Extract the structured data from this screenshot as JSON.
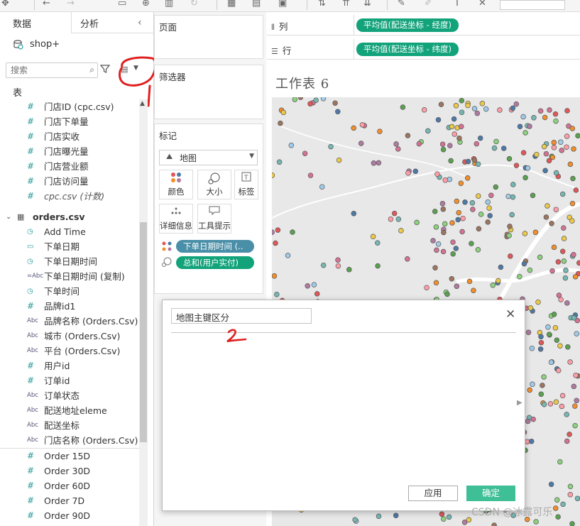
{
  "left_pane": {
    "tabs": {
      "data": "数据",
      "analysis": "分析"
    },
    "datasource": "shop+",
    "search_placeholder": "搜索",
    "section_label": "表",
    "fields": [
      {
        "label": "门店ID (cpc.csv)",
        "type": "measure"
      },
      {
        "label": "门店下单量",
        "type": "measure"
      },
      {
        "label": "门店实收",
        "type": "measure"
      },
      {
        "label": "门店曝光量",
        "type": "measure"
      },
      {
        "label": "门店营业额",
        "type": "measure"
      },
      {
        "label": "门店访问量",
        "type": "measure"
      },
      {
        "label": "cpc.csv (计数)",
        "type": "measure-italic"
      },
      {
        "label": "orders.csv",
        "type": "table"
      },
      {
        "label": "Add Time",
        "type": "datetime"
      },
      {
        "label": "下单日期",
        "type": "date"
      },
      {
        "label": "下单日期时间",
        "type": "datetime"
      },
      {
        "label": "下单日期时间 (复制)",
        "type": "string-date"
      },
      {
        "label": "下单时间",
        "type": "datetime"
      },
      {
        "label": "品牌id1",
        "type": "measure"
      },
      {
        "label": "品牌名称 (Orders.Csv)",
        "type": "string"
      },
      {
        "label": "城市 (Orders.Csv)",
        "type": "string"
      },
      {
        "label": "平台 (Orders.Csv)",
        "type": "string"
      },
      {
        "label": "用户id",
        "type": "measure"
      },
      {
        "label": "订单id",
        "type": "measure"
      },
      {
        "label": "订单状态",
        "type": "string"
      },
      {
        "label": "配送地址eleme",
        "type": "string"
      },
      {
        "label": "配送坐标",
        "type": "string"
      },
      {
        "label": "门店名称 (Orders.Csv)",
        "type": "string"
      },
      {
        "label": "Order 15D",
        "type": "measure"
      },
      {
        "label": "Order 30D",
        "type": "measure"
      },
      {
        "label": "Order 60D",
        "type": "measure"
      },
      {
        "label": "Order 7D",
        "type": "measure"
      },
      {
        "label": "Order 90D",
        "type": "measure"
      }
    ]
  },
  "shelves": {
    "pages": "页面",
    "filters": "筛选器",
    "marks": "标记",
    "mark_type": "地图",
    "mark_buttons": {
      "color": "颜色",
      "size": "大小",
      "label": "标签",
      "detail": "详细信息",
      "tooltip": "工具提示"
    },
    "mark_pills": [
      {
        "label": "下单日期时间 (..",
        "color": "#4a8fa8"
      },
      {
        "label": "总和(用户实付)",
        "color": "#12a37b"
      }
    ]
  },
  "columns_shelf": {
    "label": "列",
    "pill": "平均值(配送坐标 - 经度)"
  },
  "rows_shelf": {
    "label": "行",
    "pill": "平均值(配送坐标 - 纬度)"
  },
  "worksheet": {
    "title": "工作表 6"
  },
  "dialog": {
    "name_value": "地图主键区分",
    "apply": "应用",
    "ok": "确定"
  },
  "annotations": {
    "mark1": "1",
    "mark2": "2"
  },
  "watermark": "CSDN @冰露可乐",
  "colors": {
    "accent_green": "#12a37b",
    "pill_blue": "#4a8fa8",
    "ok_button": "#3fbf96",
    "annotation_red": "#e02020"
  }
}
